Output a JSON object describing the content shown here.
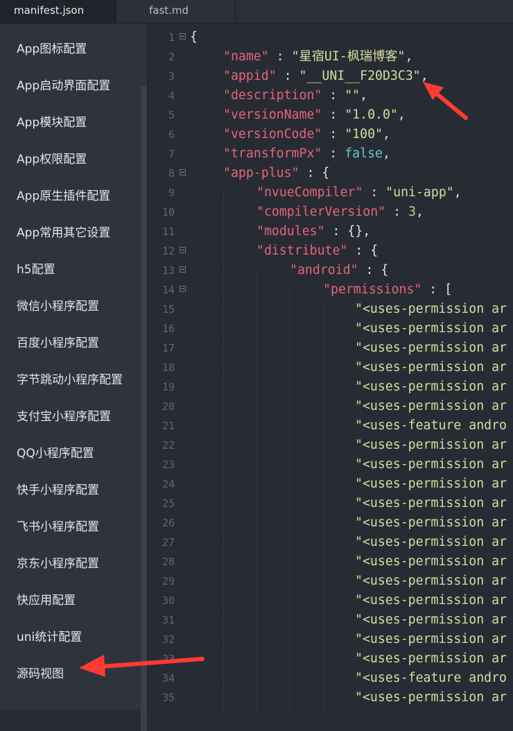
{
  "tabs": [
    {
      "label": "manifest.json",
      "active": true
    },
    {
      "label": "fast.md",
      "active": false
    }
  ],
  "sidebar": {
    "items": [
      "App图标配置",
      "App启动界面配置",
      "App模块配置",
      "App权限配置",
      "App原生插件配置",
      "App常用其它设置",
      "h5配置",
      "微信小程序配置",
      "百度小程序配置",
      "字节跳动小程序配置",
      "支付宝小程序配置",
      "QQ小程序配置",
      "快手小程序配置",
      "飞书小程序配置",
      "京东小程序配置",
      "快应用配置",
      "uni统计配置",
      "源码视图"
    ]
  },
  "editor": {
    "line_numbers": [
      "1",
      "2",
      "3",
      "4",
      "5",
      "6",
      "7",
      "8",
      "9",
      "10",
      "11",
      "12",
      "13",
      "14",
      "15",
      "16",
      "17",
      "18",
      "19",
      "20",
      "21",
      "22",
      "23",
      "24",
      "25",
      "26",
      "27",
      "28",
      "29",
      "30",
      "31",
      "32",
      "33",
      "34",
      "35"
    ],
    "tokens": {
      "open_brace": "{",
      "name_key": "\"name\"",
      "name_val": "\"星宿UI-枫瑞博客\"",
      "appid_key": "\"appid\"",
      "appid_val": "\"__UNI__F20D3C3\"",
      "desc_key": "\"description\"",
      "desc_val": "\"\"",
      "vname_key": "\"versionName\"",
      "vname_val": "\"1.0.0\"",
      "vcode_key": "\"versionCode\"",
      "vcode_val": "\"100\"",
      "tpx_key": "\"transformPx\"",
      "tpx_val": "false",
      "appplus_key": "\"app-plus\"",
      "nvue_key": "\"nvueCompiler\"",
      "nvue_val": "\"uni-app\"",
      "cver_key": "\"compilerVersion\"",
      "cver_val": "3",
      "modules_key": "\"modules\"",
      "modules_val": "{}",
      "dist_key": "\"distribute\"",
      "android_key": "\"android\"",
      "perm_key": "\"permissions\"",
      "perm_open": "[",
      "uses_permission": "\"<uses-permission ar",
      "uses_feature": "\"<uses-feature andro",
      "colon": " : ",
      "comma": ",",
      "brace_open": " {"
    }
  },
  "colors": {
    "key": "#e8637a",
    "string": "#d8dca0",
    "number": "#d8c27a",
    "boolean": "#62c7d2",
    "arrow": "#ff3b30"
  }
}
